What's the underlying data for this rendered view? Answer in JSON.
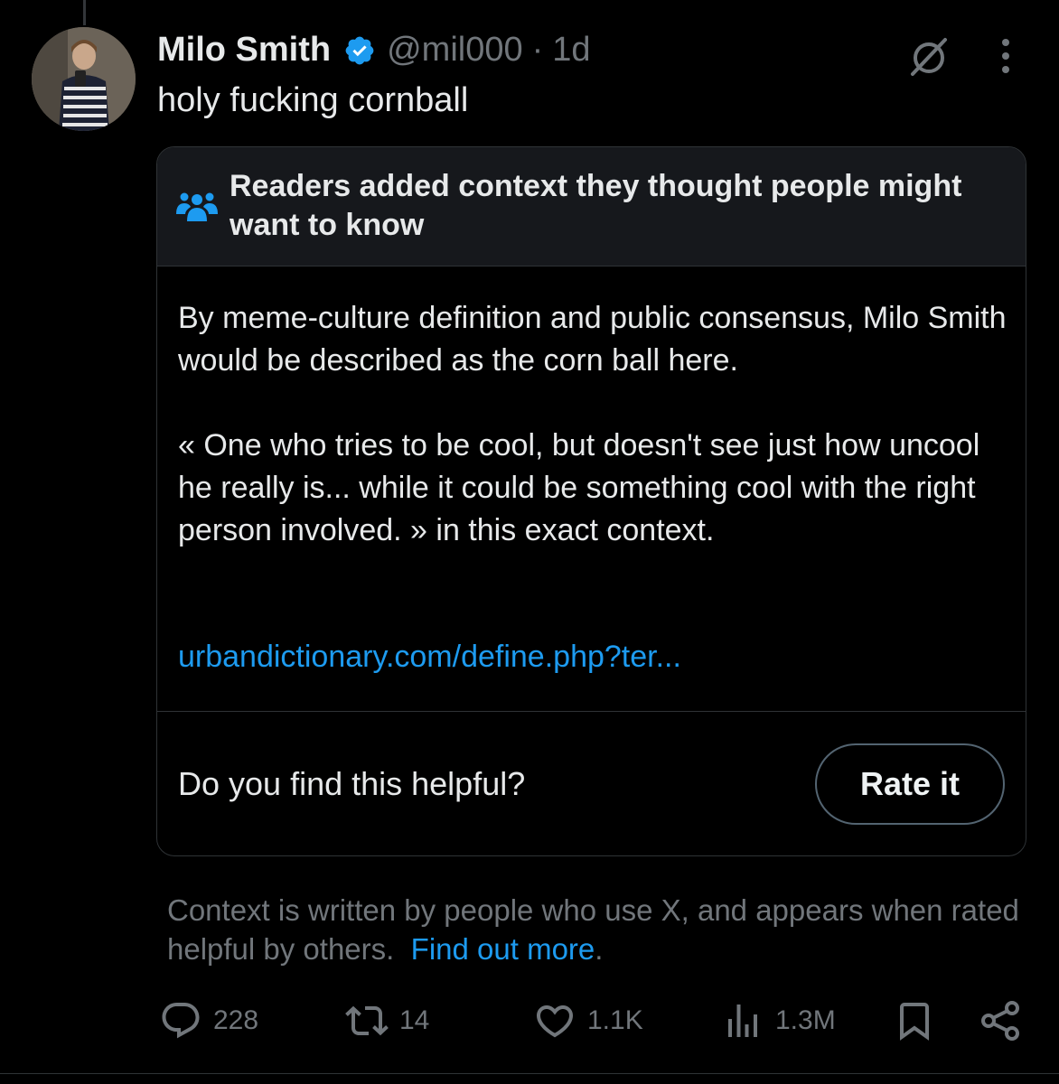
{
  "tweet": {
    "author_name": "Milo Smith",
    "handle": "@mil000",
    "separator": "·",
    "time": "1d",
    "text": "holy fucking cornball",
    "verified": true
  },
  "community_note": {
    "title": "Readers added context they thought people might want to know",
    "body_paragraph_1": "By meme-culture definition and public consensus, Milo Smith would be described as the corn ball here.",
    "body_paragraph_2": "« One who tries to be cool, but doesn't see just how uncool he really is... while it could be something cool with the right person involved. » in this exact context.",
    "link_text": "urbandictionary.com/define.php?ter...",
    "helpful_question": "Do you find this helpful?",
    "rate_button_label": "Rate it"
  },
  "context_footer": {
    "text": "Context is written by people who use X, and appears when rated helpful by others.",
    "link_text": "Find out more",
    "trailing": "."
  },
  "actions": {
    "replies": "228",
    "reposts": "14",
    "likes": "1.1K",
    "views": "1.3M"
  },
  "icons": {
    "verified": "verified-badge-icon",
    "grok": "grok-icon",
    "more": "more-vertical-icon",
    "community_notes": "people-group-icon",
    "reply": "reply-icon",
    "repost": "repost-icon",
    "like": "heart-icon",
    "views": "analytics-icon",
    "bookmark": "bookmark-icon",
    "share": "share-icon"
  },
  "colors": {
    "background": "#000000",
    "text_primary": "#e7e9ea",
    "text_secondary": "#71767b",
    "accent_blue": "#1d9bf0",
    "border": "#2f3336",
    "note_header_bg": "#16181c"
  }
}
